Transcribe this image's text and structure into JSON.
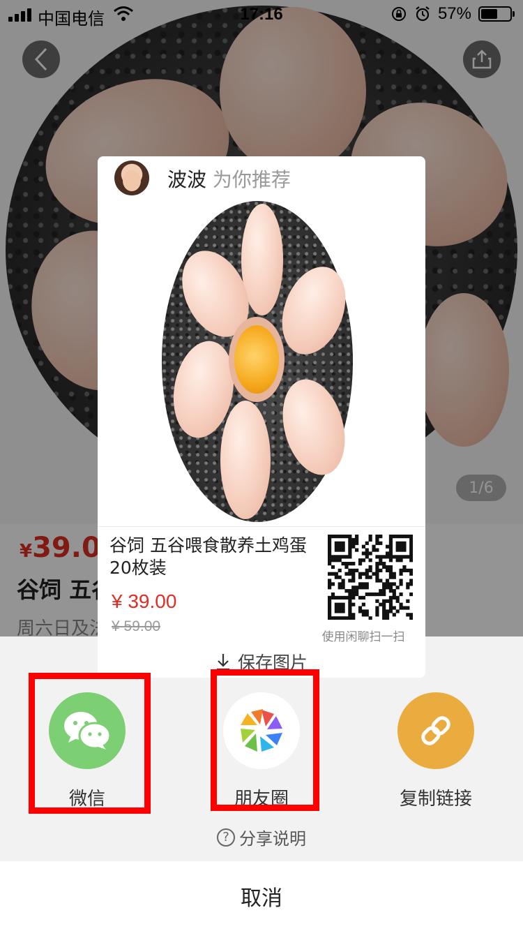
{
  "status_bar": {
    "carrier": "中国电信",
    "time": "17:16",
    "battery": "57%",
    "battery_level": 0.57
  },
  "product_page": {
    "pager": "1/6",
    "price_currency": "¥",
    "price": "39.00",
    "title": "谷饲  五谷",
    "subtitle": "周六日及法"
  },
  "poster": {
    "user_name": "波波",
    "recommend_text": "为你推荐",
    "title": "谷饲  五谷喂食散养土鸡蛋20枚装",
    "price": "¥ 39.00",
    "original_price": "¥ 59.00",
    "qr_caption": "使用闲聊扫一扫",
    "save_label": "保存图片"
  },
  "share_sheet": {
    "options": [
      {
        "label": "微信",
        "icon": "wechat-icon",
        "color": "#7ccf72"
      },
      {
        "label": "朋友圈",
        "icon": "moments-icon",
        "color": "#ffffff"
      },
      {
        "label": "复制链接",
        "icon": "link-icon",
        "color": "#eaab3f"
      }
    ],
    "help_text": "分享说明",
    "cancel_label": "取消"
  },
  "highlight_color": "#ff0000"
}
